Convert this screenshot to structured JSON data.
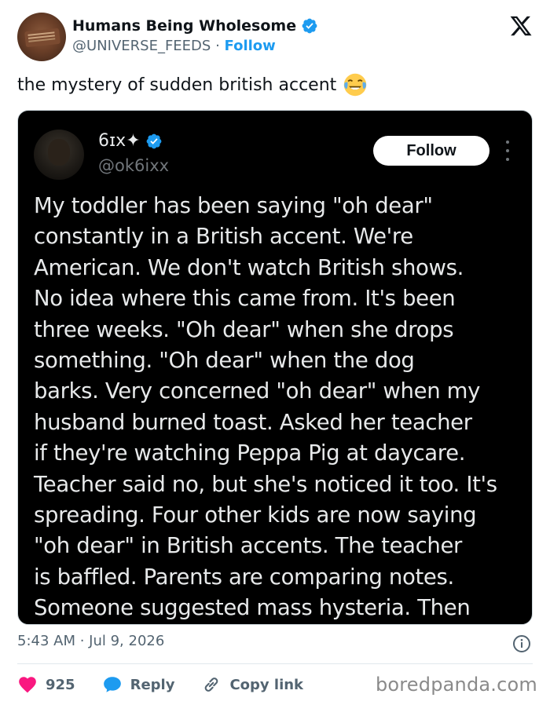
{
  "header": {
    "account_name": "Humans Being Wholesome",
    "handle": "@UNIVERSE_FEEDS",
    "separator": "·",
    "follow_label": "Follow",
    "verified_icon": "verified-badge-icon",
    "platform_logo": "x-logo-icon"
  },
  "tweet": {
    "text": "the mystery of sudden british accent",
    "emoji": "😂",
    "timestamp": "5:43 AM · Jul 9, 2026"
  },
  "embedded": {
    "name": "6ɪx✦",
    "handle": "@ok6ixx",
    "follow_label": "Follow",
    "lines": [
      "My toddler has been saying \"oh dear\"",
      "constantly in a British accent. We're",
      "American. We don't watch British shows.",
      "No idea where this came from. It's been",
      "three weeks. \"Oh dear\" when she drops",
      "something. \"Oh dear\" when the dog",
      "barks. Very concerned \"oh dear\" when my",
      "husband burned toast. Asked her teacher",
      "if they're watching Peppa Pig at daycare.",
      "Teacher said no, but she's noticed it too. It's",
      "spreading. Four other kids are now saying",
      "\"oh dear\" in British accents. The teacher",
      "is baffled. Parents are comparing notes.",
      "Someone suggested mass hysteria. Then"
    ]
  },
  "actions": {
    "like_count": "925",
    "reply_label": "Reply",
    "copy_label": "Copy link"
  },
  "watermark": "boredpanda.com",
  "colors": {
    "accent": "#1d9bf0",
    "like": "#f91880",
    "muted": "#536471",
    "embed_bg": "#000000"
  }
}
